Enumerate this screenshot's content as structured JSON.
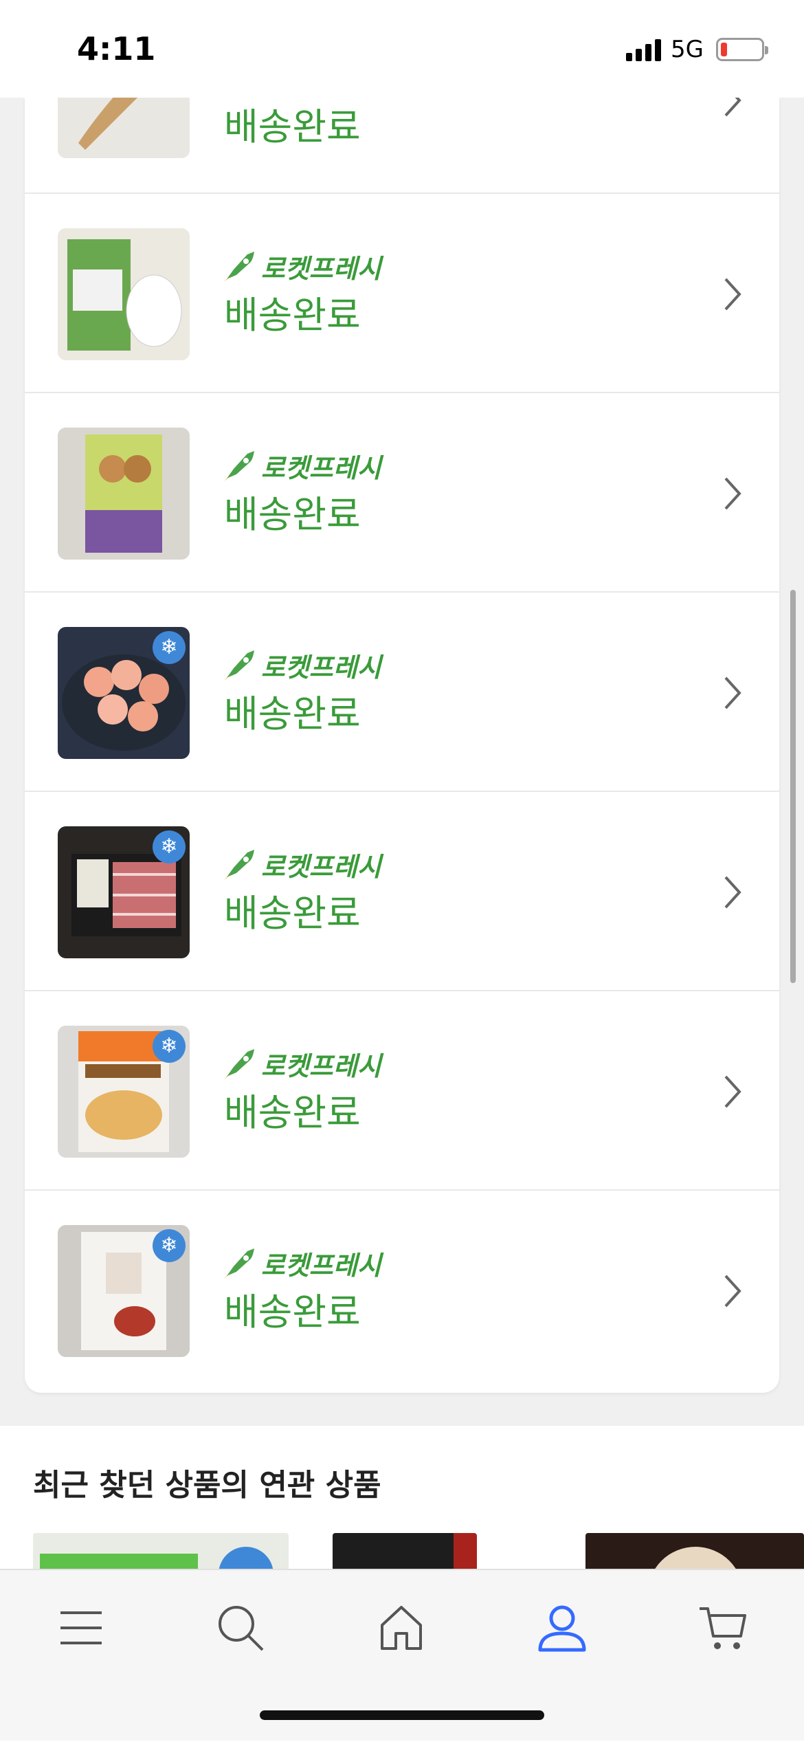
{
  "status_bar": {
    "time": "4:11",
    "network": "5G",
    "battery_color": "#ee3b2f"
  },
  "orders": {
    "items": [
      {
        "brand_label": "",
        "status": "배송완료",
        "image": "food-product-image",
        "frozen": false
      },
      {
        "brand_label": "로켓프레시",
        "status": "배송완료",
        "image": "food-product-image",
        "frozen": false
      },
      {
        "brand_label": "로켓프레시",
        "status": "배송완료",
        "image": "food-product-image",
        "frozen": false
      },
      {
        "brand_label": "로켓프레시",
        "status": "배송완료",
        "image": "shrimp-product-image",
        "frozen": true,
        "badge": "냉동"
      },
      {
        "brand_label": "로켓프레시",
        "status": "배송완료",
        "image": "meat-product-image",
        "frozen": true,
        "badge": "냉동"
      },
      {
        "brand_label": "로켓프레시",
        "status": "배송완료",
        "image": "food-product-image",
        "frozen": true,
        "badge": "냉동"
      },
      {
        "brand_label": "로켓프레시",
        "status": "배송완료",
        "image": "food-product-image",
        "frozen": true,
        "badge": "냉동"
      }
    ],
    "status_color": "#3a9b3a"
  },
  "recommendations": {
    "title": "최근 찾던 상품의 연관 상품"
  },
  "bottom_nav": {
    "items": [
      {
        "icon": "menu-icon",
        "active": false
      },
      {
        "icon": "search-icon",
        "active": false
      },
      {
        "icon": "home-icon",
        "active": false
      },
      {
        "icon": "profile-icon",
        "active": true
      },
      {
        "icon": "cart-icon",
        "active": false
      }
    ],
    "active_color": "#346aff",
    "inactive_color": "#555555"
  }
}
